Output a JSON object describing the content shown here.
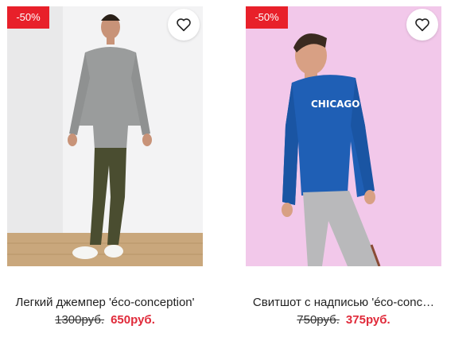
{
  "products": [
    {
      "discount_badge": "-50%",
      "title": "Легкий джемпер 'éco-conception'",
      "old_price": "1300руб.",
      "new_price": "650руб.",
      "favorite_icon": "heart-outline-icon"
    },
    {
      "discount_badge": "-50%",
      "title": "Свитшот с надписью 'éco-conc…",
      "old_price": "750руб.",
      "new_price": "375руб.",
      "print_text": "CHICAGO",
      "favorite_icon": "heart-outline-icon"
    }
  ],
  "colors": {
    "badge": "#e8202a",
    "new_price": "#e02a3a",
    "photo2_background": "#f2c8ea"
  }
}
